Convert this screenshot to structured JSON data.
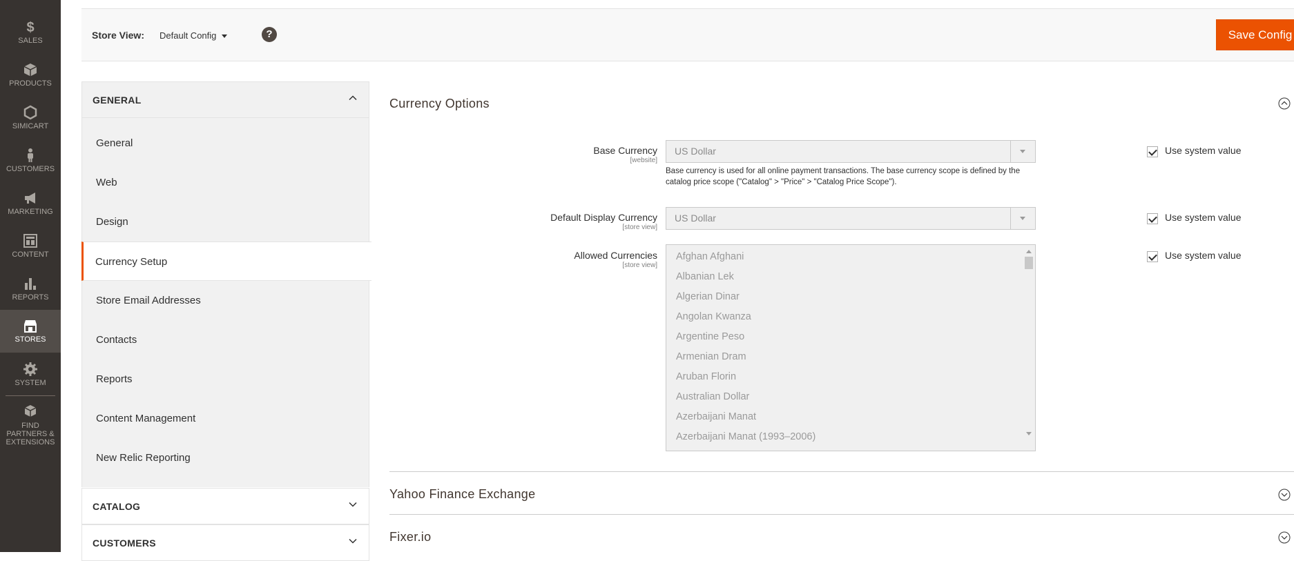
{
  "nav": {
    "items": [
      {
        "label": "SALES",
        "icon": "dollar-icon"
      },
      {
        "label": "PRODUCTS",
        "icon": "cube-icon"
      },
      {
        "label": "SIMICART",
        "icon": "hexagon-icon"
      },
      {
        "label": "CUSTOMERS",
        "icon": "person-icon"
      },
      {
        "label": "MARKETING",
        "icon": "megaphone-icon"
      },
      {
        "label": "CONTENT",
        "icon": "layout-icon"
      },
      {
        "label": "REPORTS",
        "icon": "bar-chart-icon"
      },
      {
        "label": "STORES",
        "icon": "storefront-icon"
      },
      {
        "label": "SYSTEM",
        "icon": "gear-icon"
      },
      {
        "label": "FIND PARTNERS & EXTENSIONS",
        "icon": "boxes-icon"
      }
    ],
    "active": "STORES"
  },
  "header": {
    "store_view_label": "Store View:",
    "store_view_value": "Default Config",
    "help_symbol": "?",
    "save_label": "Save Config"
  },
  "tabs": {
    "general_title": "GENERAL",
    "general_items": [
      "General",
      "Web",
      "Design",
      "Currency Setup",
      "Store Email Addresses",
      "Contacts",
      "Reports",
      "Content Management",
      "New Relic Reporting"
    ],
    "active_item": "Currency Setup",
    "catalog_title": "CATALOG",
    "customers_title": "CUSTOMERS"
  },
  "currency_options": {
    "title": "Currency Options",
    "base_currency": {
      "label": "Base Currency",
      "scope": "[website]",
      "value": "US Dollar",
      "note": "Base currency is used for all online payment transactions. The base currency scope is defined by the catalog price scope (\"Catalog\" > \"Price\" > \"Catalog Price Scope\").",
      "use_system": "Use system value"
    },
    "default_display": {
      "label": "Default Display Currency",
      "scope": "[store view]",
      "value": "US Dollar",
      "use_system": "Use system value"
    },
    "allowed": {
      "label": "Allowed Currencies",
      "scope": "[store view]",
      "options": [
        "Afghan Afghani",
        "Albanian Lek",
        "Algerian Dinar",
        "Angolan Kwanza",
        "Argentine Peso",
        "Armenian Dram",
        "Aruban Florin",
        "Australian Dollar",
        "Azerbaijani Manat",
        "Azerbaijani Manat (1993–2006)"
      ],
      "use_system": "Use system value"
    }
  },
  "sections": {
    "yahoo": "Yahoo Finance Exchange",
    "fixer": "Fixer.io"
  },
  "colors": {
    "accent": "#eb5202",
    "nav_bg": "#373330",
    "nav_active": "#524d49"
  }
}
